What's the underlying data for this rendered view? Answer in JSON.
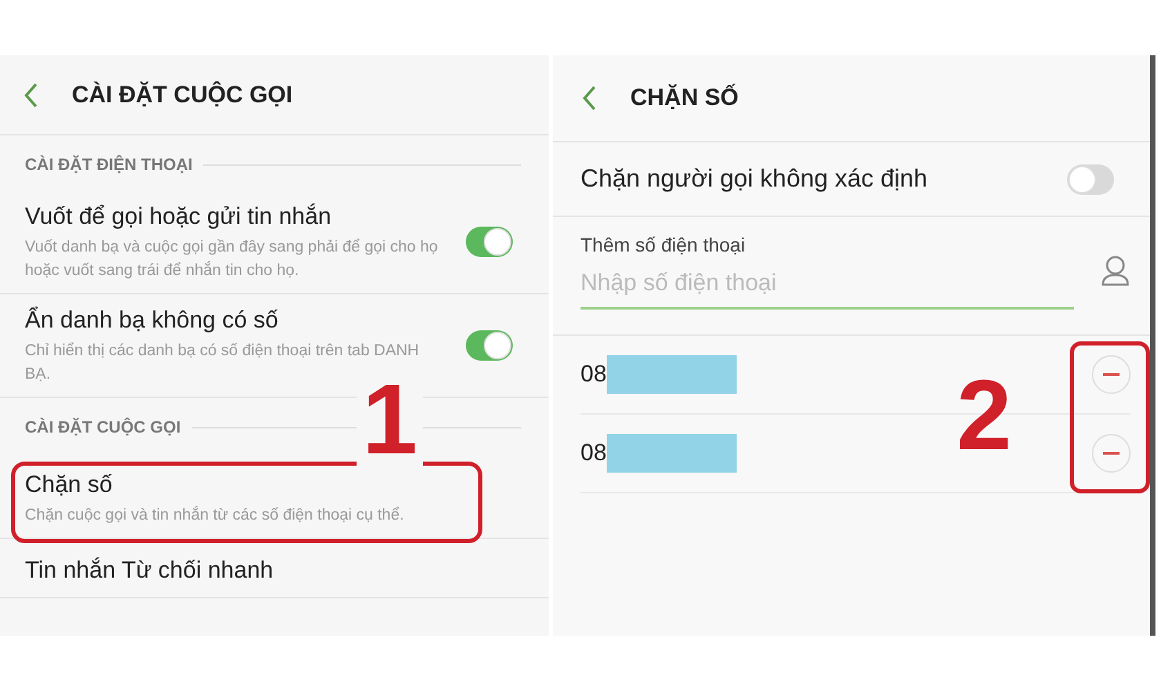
{
  "left_screen": {
    "title": "CÀI ĐẶT CUỘC GỌI",
    "sections": [
      {
        "header": "CÀI ĐẶT ĐIỆN THOẠI",
        "items": [
          {
            "kind": "toggle",
            "title": "Vuốt để gọi hoặc gửi tin nhắn",
            "description": "Vuốt danh bạ và cuộc gọi gần đây sang phải để gọi cho họ hoặc vuốt sang trái để nhắn tin cho họ.",
            "on": true,
            "highlighted": false
          },
          {
            "kind": "toggle",
            "title": "Ẩn danh bạ không có số",
            "description": "Chỉ hiển thị các danh bạ có số điện thoại trên tab DANH BẠ.",
            "on": true,
            "highlighted": false
          }
        ]
      },
      {
        "header": "CÀI ĐẶT CUỘC GỌI",
        "items": [
          {
            "kind": "link",
            "title": "Chặn số",
            "description": "Chặn cuộc gọi và tin nhắn từ các số điện thoại cụ thể.",
            "highlighted": true
          },
          {
            "kind": "link",
            "title": "Tin nhắn Từ chối nhanh",
            "highlighted": false
          }
        ]
      }
    ]
  },
  "right_screen": {
    "title": "CHẶN SỐ",
    "unknown_toggle": {
      "label": "Chặn người gọi không xác định",
      "on": false
    },
    "add_field": {
      "label": "Thêm số điện thoại",
      "placeholder": "Nhập số điện thoại"
    },
    "blocked_numbers": [
      {
        "number": "08"
      },
      {
        "number": "08"
      }
    ],
    "remove_buttons_highlighted": true
  },
  "annotations": [
    {
      "label": "1"
    },
    {
      "label": "2"
    }
  ]
}
